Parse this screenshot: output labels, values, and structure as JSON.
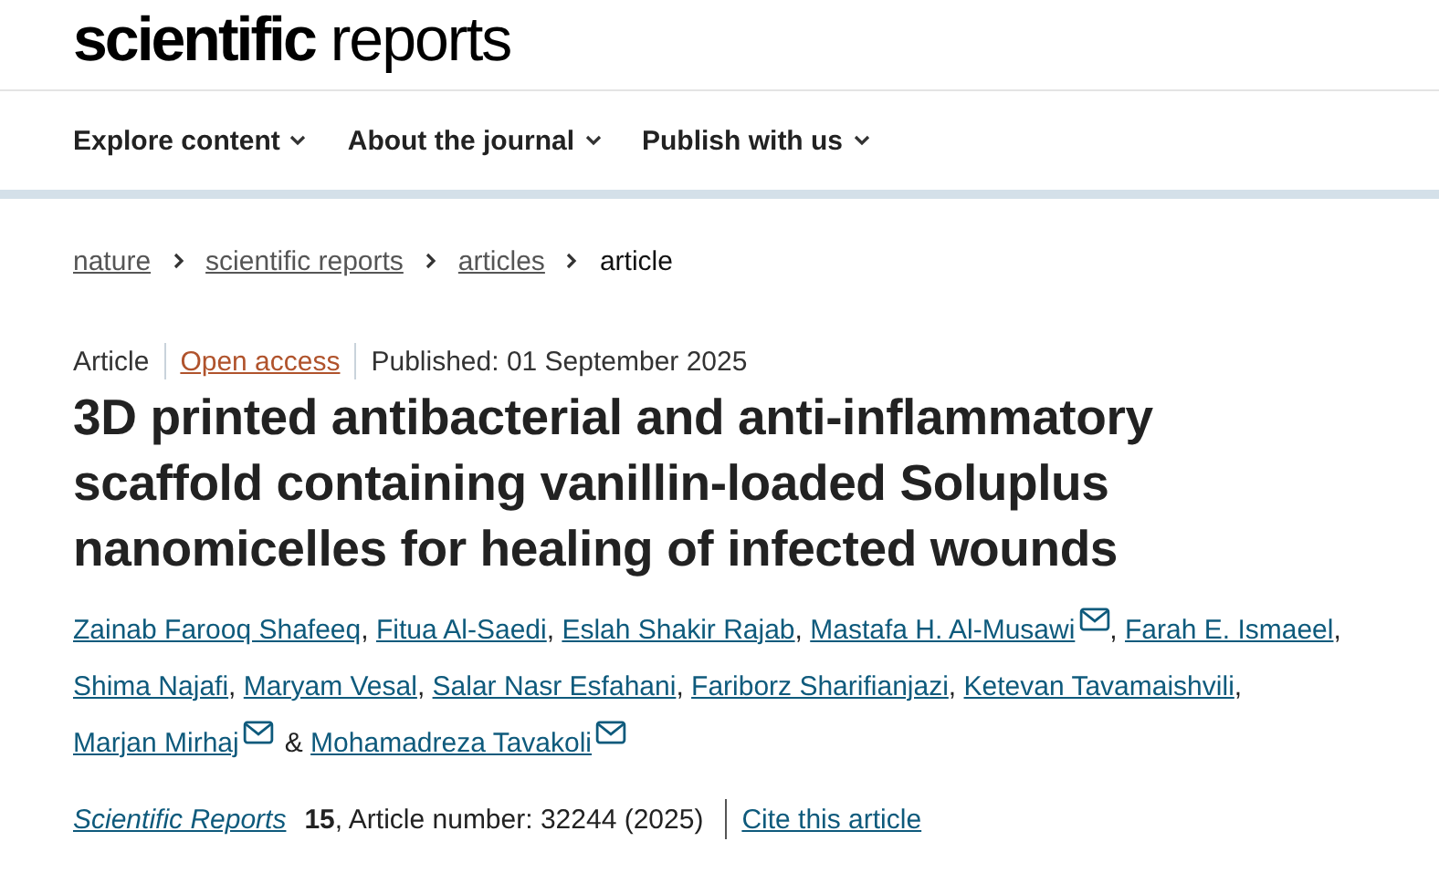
{
  "logo": {
    "bold": "scientific",
    "light": "reports"
  },
  "nav": [
    {
      "label": "Explore content"
    },
    {
      "label": "About the journal"
    },
    {
      "label": "Publish with us"
    }
  ],
  "breadcrumbs": [
    {
      "label": "nature",
      "kind": "link"
    },
    {
      "label": "scientific reports",
      "kind": "link"
    },
    {
      "label": "articles",
      "kind": "link"
    },
    {
      "label": "article",
      "kind": "current"
    }
  ],
  "meta": {
    "type": "Article",
    "access": "Open access",
    "published": "Published: 01 September 2025"
  },
  "title": "3D printed antibacterial and anti-inflammatory scaffold containing vanillin-loaded Soluplus nanomicelles for healing of infected wounds",
  "authors": [
    {
      "name": "Zainab Farooq Shafeeq",
      "mail": false,
      "sep": ","
    },
    {
      "name": "Fitua Al-Saedi",
      "mail": false,
      "sep": ","
    },
    {
      "name": "Eslah Shakir Rajab",
      "mail": false,
      "sep": ","
    },
    {
      "name": "Mastafa H. Al-Musawi",
      "mail": true,
      "sep": ","
    },
    {
      "name": "Farah E. Ismaeel",
      "mail": false,
      "sep": ","
    },
    {
      "name": "Shima Najafi",
      "mail": false,
      "sep": ","
    },
    {
      "name": "Maryam Vesal",
      "mail": false,
      "sep": ","
    },
    {
      "name": "Salar Nasr Esfahani",
      "mail": false,
      "sep": ","
    },
    {
      "name": "Fariborz Sharifianjazi",
      "mail": false,
      "sep": ","
    },
    {
      "name": "Ketevan Tavamaishvili",
      "mail": false,
      "sep": ","
    },
    {
      "name": "Marjan Mirhaj",
      "mail": true,
      "sep": "&"
    },
    {
      "name": "Mohamadreza Tavakoli",
      "mail": true
    }
  ],
  "citation": {
    "journal": "Scientific Reports",
    "details": "**15**, Article number: 32244 (2025)",
    "cite": "Cite this article"
  }
}
